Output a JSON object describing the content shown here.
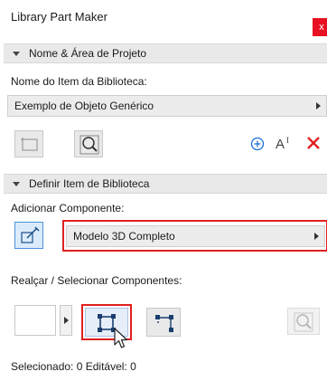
{
  "window": {
    "title": "Library Part Maker",
    "close_glyph": "x"
  },
  "section1": {
    "header": "Nome & Área de Projeto",
    "item_name_label": "Nome do Item da Biblioteca:",
    "item_name_value": "Exemplo de Objeto Genérico",
    "tools": [
      "rectangle-select-icon",
      "zoom-to-fit-icon",
      "add-icon",
      "text-size-icon",
      "delete-icon"
    ]
  },
  "section2": {
    "header": "Definir Item de Biblioteca",
    "add_component_label": "Adicionar Componente:",
    "add_component_value": "Modelo 3D Completo",
    "highlight_label": "Realçar / Selecionar Componentes:",
    "status_text": "Selecionado: 0 Editável: 0"
  },
  "colors": {
    "highlight_red": "#e02020",
    "delete_red": "#e02020",
    "accent_blue": "#1a6fd6",
    "close_red": "#e81123"
  }
}
